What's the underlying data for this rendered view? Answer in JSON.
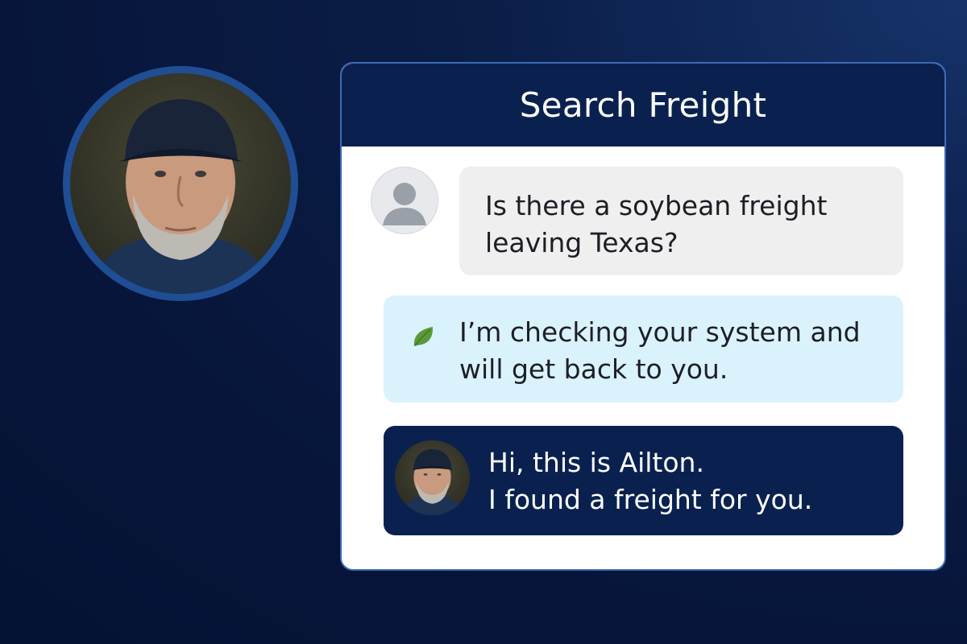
{
  "card": {
    "title": "Search Freight"
  },
  "messages": {
    "user": {
      "line1": "Is there a soybean freight",
      "line2": "leaving Texas?"
    },
    "system": {
      "line1": "I’m checking your system and",
      "line2": "will get back to you."
    },
    "agent": {
      "line1": "Hi, this is Ailton.",
      "line2": "I found a freight for you."
    }
  },
  "icons": {
    "user_avatar": "person-icon",
    "system_icon": "leaf-icon",
    "agent_avatar": "agent-avatar",
    "profile": "profile-photo"
  },
  "colors": {
    "background": "#07153a",
    "header": "#0a2150",
    "avatar_ring": "#1f4e94",
    "user_bubble": "#efefef",
    "system_bubble": "#daf2fb",
    "agent_bubble": "#0a2150",
    "leaf": "#5b9a3a"
  }
}
